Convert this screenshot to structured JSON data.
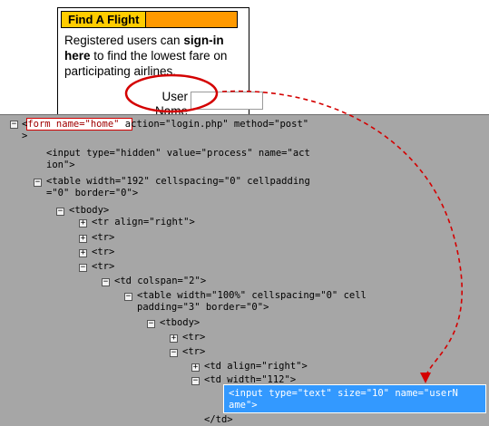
{
  "widget": {
    "title": "Find A Flight",
    "text_1": "Registered users can ",
    "text_bold_1": "sign-in",
    "text_bold_2": "here",
    "text_2": " to find the lowest fare on participating airlines.",
    "user_label_1": "User",
    "user_label_2": "Name"
  },
  "tree": {
    "l1_a": "<",
    "l1_b": "form name=\"home\"",
    "l1_c": " action=\"login.php\" method=\"post\"",
    "l2": ">",
    "l3": "<input type=\"hidden\" value=\"process\" name=\"act",
    "l4": "ion\">",
    "l5": "<table width=\"192\" cellspacing=\"0\" cellpadding",
    "l6": "=\"0\" border=\"0\">",
    "l7": "<tbody>",
    "l8": "<tr align=\"right\">",
    "l9": "<tr>",
    "l10": "<tr>",
    "l11": "<tr>",
    "l12": "<td colspan=\"2\">",
    "l13": "<table width=\"100%\" cellspacing=\"0\" cell",
    "l14": "padding=\"3\" border=\"0\">",
    "l15": "<tbody>",
    "l16": "<tr>",
    "l17": "<tr>",
    "l18": "<td align=\"right\">",
    "l19": "<td width=\"112\">",
    "l20": "<input type=\"text\" size=\"10\" name=\"userN",
    "l21": "ame\">",
    "l22": "</td>"
  },
  "colors": {
    "panel": "#a6a6a6",
    "selection": "#3399ff",
    "annotation": "#d40000",
    "header_yellow": "#ffcc00",
    "header_orange": "#ff9900"
  }
}
